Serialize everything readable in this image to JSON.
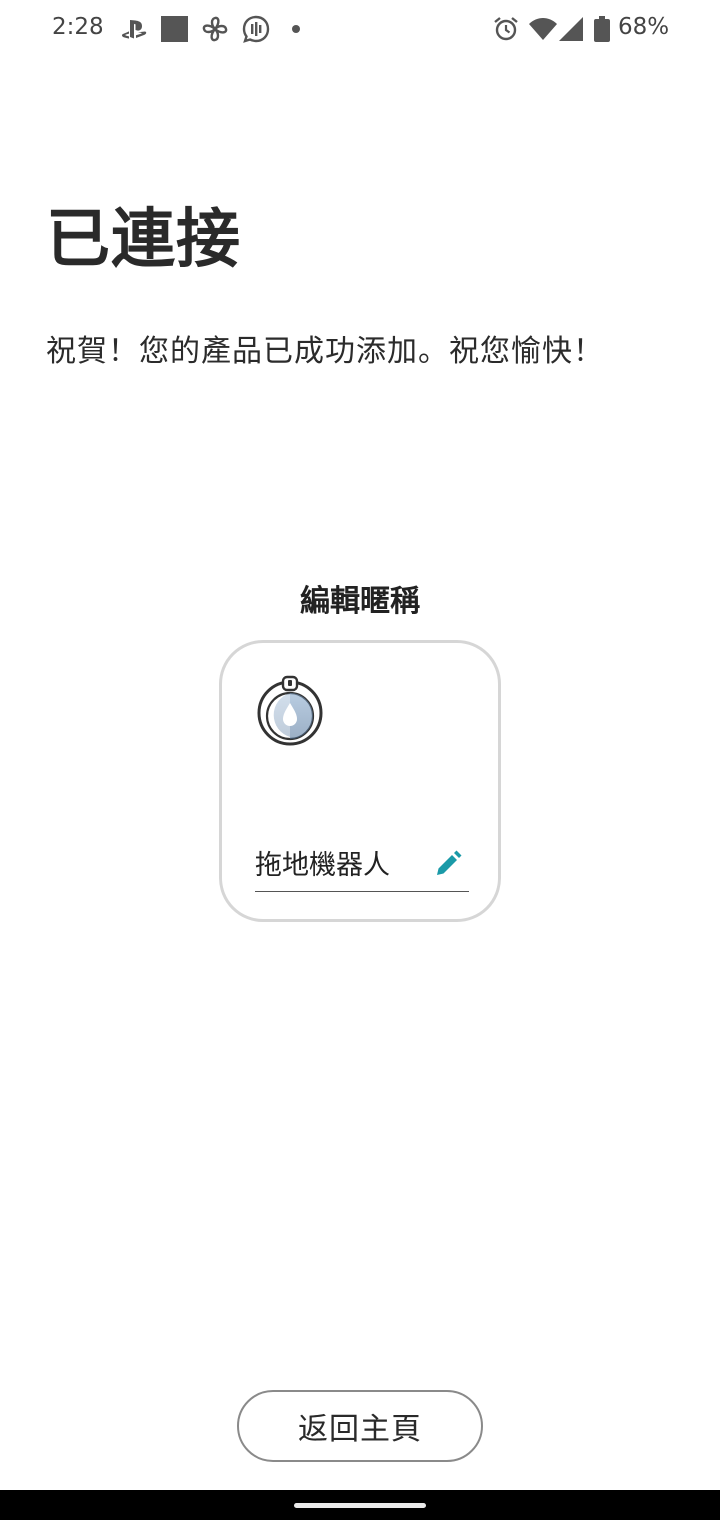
{
  "status_bar": {
    "time": "2:28",
    "battery_percent": "68%",
    "left_icons": [
      "playstation-icon",
      "square-app-icon",
      "fan-icon",
      "voice-bubble-icon",
      "dot-icon"
    ],
    "right_icons": [
      "alarm-icon",
      "wifi-icon",
      "signal-icon",
      "battery-icon"
    ]
  },
  "page": {
    "title": "已連接",
    "subtitle": "祝賀！您的產品已成功添加。祝您愉快！",
    "section_label": "編輯暱稱"
  },
  "device_card": {
    "icon": "mop-robot-icon",
    "name": "拖地機器人",
    "edit_icon": "pencil-icon",
    "accent_color": "#1a9aa8"
  },
  "footer": {
    "home_button_label": "返回主頁"
  }
}
